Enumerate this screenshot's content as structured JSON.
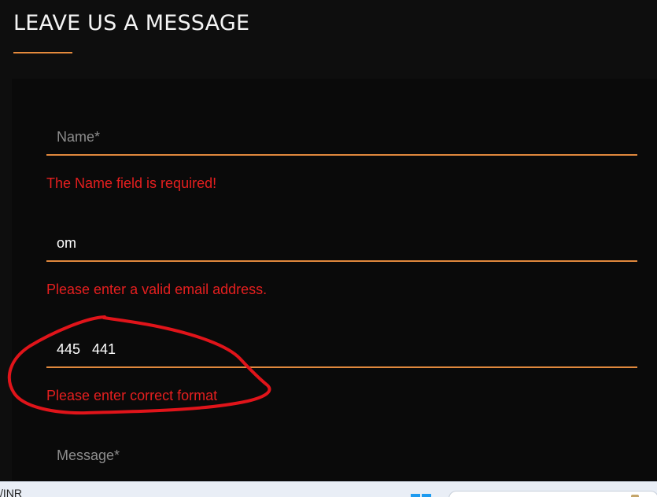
{
  "form": {
    "heading": "LEAVE US A MESSAGE",
    "name_field": {
      "placeholder": "Name*",
      "value": ""
    },
    "name_error": "The Name field is required!",
    "email_field": {
      "value": "om"
    },
    "email_error": "Please enter a valid email address.",
    "phone_field": {
      "value": "445   441"
    },
    "phone_error": "Please enter correct format",
    "message_field": {
      "placeholder": "Message*"
    }
  },
  "taskbar": {
    "partial_text": "/INR"
  },
  "colors": {
    "accent": "#e58a3c",
    "error": "#e51f1f",
    "annotation": "#e0141a",
    "background": "#0e0e0e"
  },
  "icons": [
    "windows-start-icon",
    "search-icon"
  ]
}
